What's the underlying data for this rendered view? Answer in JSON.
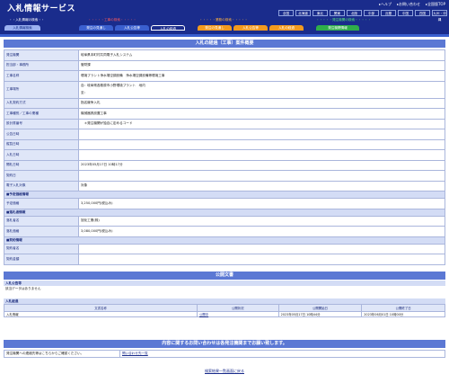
{
  "header": {
    "title": "入札情報サービス",
    "links": [
      "ヘルプ",
      "お問い合わせ",
      "全国版TOP"
    ],
    "regions": [
      "全国",
      "北海道",
      "東北",
      "関東",
      "北陸",
      "中部",
      "近畿",
      "中国",
      "四国",
      "九州・沖縄"
    ]
  },
  "categories": {
    "construction_label": "工事の検索",
    "consulting_label": "業務の検索",
    "order_label": "発注機関の検索",
    "search_label": "入札情報の検索",
    "tabs": [
      "入札情報検索",
      "発注の見通し",
      "入札公告等",
      "入札の経過",
      "発注の見通し",
      "入札公告等",
      "入札の経過",
      "発注機関情報"
    ]
  },
  "detail": {
    "title": "入札の経過（工事）案件概要",
    "rows": [
      {
        "k": "発注機関",
        "v": "岐阜県本町村共同電子入札システム"
      },
      {
        "k": "担当部・事務所",
        "v": "管財課"
      },
      {
        "k": "工事名称",
        "v": "環境プラント浄水場空調設備　浄水場空調設備等環境工事"
      },
      {
        "k": "工事場所",
        "v": "自：岐阜県各務原市小野環境プラント　地内",
        "v2": "至："
      },
      {
        "k": "入札契約方式",
        "v": "指名競争入札"
      },
      {
        "k": "工事種別／工事の業種",
        "v": "機械器具設置工事"
      },
      {
        "k": "設計書番号",
        "v": "　＊発注機関が独自に定めるコード"
      },
      {
        "k": "公告日時",
        "v": ""
      },
      {
        "k": "縦覧日時",
        "v": ""
      },
      {
        "k": "入札日時",
        "v": ""
      },
      {
        "k": "開札日時",
        "v": "2023年05月17日 10時17分"
      },
      {
        "k": "契約日",
        "v": ""
      },
      {
        "k": "電子入札対象",
        "v": "対象"
      }
    ],
    "price_group": "■予定価格情報",
    "price_label": "予定価格",
    "price_value": "3,250,000円(税込み)",
    "winner_group": "■落札者情報",
    "winner_label": "落札者名",
    "winner_value": "旭化工業(株)",
    "winner_price_label": "落札価格",
    "winner_price_value": "3,080,000円(税込み)",
    "contract_group": "■契約情報",
    "contractor_label": "契約者名",
    "contract_amount_label": "契約金額"
  },
  "docs": {
    "title": "公開文書",
    "notice_bar": "入札公告等",
    "notice_text": "該当データはありません",
    "progress_bar": "入札経過",
    "columns": [
      "文書名称",
      "公開状況",
      "公開開始日",
      "公開終了日"
    ],
    "row": [
      "入札情報",
      "公開中",
      "2023年05月17日 10時44分",
      "2023年06月01日 10時00分"
    ]
  },
  "contact": {
    "title": "内容に関するお問い合わせは各発注機関までお願い致します。",
    "label": "発注機関への連絡先等はこちらからご確認ください。",
    "link": "問い合わせ先一覧"
  },
  "back_link": "検索結果一覧画面に戻る"
}
